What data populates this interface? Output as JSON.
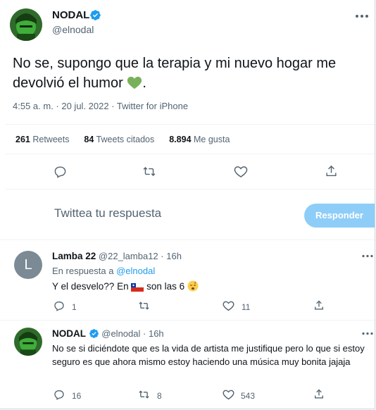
{
  "main_tweet": {
    "author_name": "NODAL",
    "author_handle": "@elnodal",
    "text": "No se, supongo que la terapia y mi nuevo hogar me devolvió el humor",
    "text_suffix": ".",
    "timestamp": "4:55 a. m. · 20 jul. 2022 · Twitter for iPhone",
    "stats": {
      "retweets_count": "261",
      "retweets_label": "Retweets",
      "quotes_count": "84",
      "quotes_label": "Tweets citados",
      "likes_count": "8.894",
      "likes_label": "Me gusta"
    }
  },
  "reply_box": {
    "placeholder": "Twittea tu respuesta",
    "button_label": "Responder"
  },
  "replies": [
    {
      "avatar_letter": "L",
      "author_name": "Lamba 22",
      "author_handle": "@22_lamba12",
      "time": "16h",
      "replying_to_label": "En respuesta a",
      "replying_to_handle": "@elnodal",
      "text_before": "Y el desvelo?? En",
      "text_after": "son las 6",
      "reply_count": "1",
      "retweet_count": "",
      "like_count": "11"
    },
    {
      "author_name": "NODAL",
      "author_handle": "@elnodal",
      "time": "16h",
      "text": "No se si diciéndote que es la vida de artista me justifique pero lo que si estoy seguro es que ahora mismo estoy haciendo una música muy bonita jajaja",
      "reply_count": "16",
      "retweet_count": "8",
      "like_count": "543"
    }
  ],
  "colors": {
    "accent": "#1d9bf0",
    "reply_button": "#8ecdf8",
    "heart": "#78b159"
  }
}
